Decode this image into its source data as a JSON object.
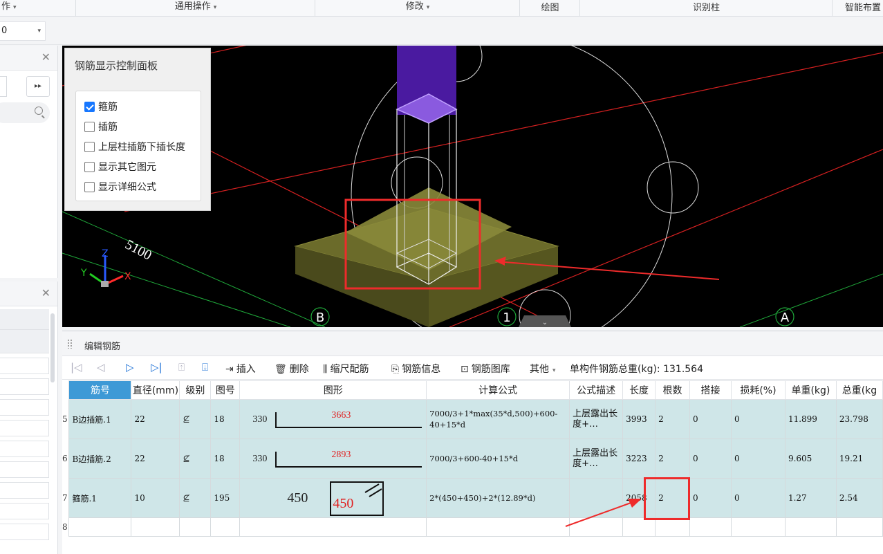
{
  "ribbon": {
    "groups": [
      {
        "label": "作",
        "caret": "▾"
      },
      {
        "label": "通用操作",
        "caret": "▾"
      },
      {
        "label": "修改",
        "caret": "▾"
      },
      {
        "label": "绘图",
        "caret": ""
      },
      {
        "label": "识别柱",
        "caret": ""
      },
      {
        "label": "智能布置",
        "caret": ""
      }
    ]
  },
  "subbar": {
    "zoom_value": "0"
  },
  "left_panel_top": {
    "expand_btn": "▸▸"
  },
  "control_panel": {
    "title": "钢筋显示控制面板",
    "options": [
      {
        "label": "箍筋",
        "checked": true
      },
      {
        "label": "插筋",
        "checked": false
      },
      {
        "label": "上层柱插筋下插长度",
        "checked": false
      },
      {
        "label": "显示其它图元",
        "checked": false
      },
      {
        "label": "显示详细公式",
        "checked": false
      }
    ]
  },
  "viewport": {
    "dim_label": "5100",
    "axis_x": "X",
    "axis_y": "Y",
    "axis_z": "Z",
    "grid_labels": [
      "B",
      "1",
      "A"
    ]
  },
  "edit_panel": {
    "title": "编辑钢筋",
    "tools": {
      "insert": "插入",
      "delete": "删除",
      "scale_rebar": "缩尺配筋",
      "rebar_info": "钢筋信息",
      "rebar_library": "钢筋图库",
      "other": "其他",
      "total_weight_label": "单构件钢筋总重(kg):",
      "total_weight_value": "131.564"
    },
    "columns": [
      "筋号",
      "直径(mm)",
      "级别",
      "图号",
      "图形",
      "计算公式",
      "公式描述",
      "长度",
      "根数",
      "搭接",
      "损耗(%)",
      "单重(kg)",
      "总重(kg"
    ],
    "rows": [
      {
        "num": "5",
        "name": "B边插筋.1",
        "diameter": "22",
        "grade": "⊈",
        "fig": "18",
        "shape_left": "330",
        "shape_red": "3663",
        "formula": "7000/3+1*max(35*d,500)+600-40+15*d",
        "desc": "上层露出长度+…",
        "length": "3993",
        "count": "2",
        "lap": "0",
        "loss": "0",
        "unit_w": "11.899",
        "total_w": "23.798"
      },
      {
        "num": "6",
        "name": "B边插筋.2",
        "diameter": "22",
        "grade": "⊈",
        "fig": "18",
        "shape_left": "330",
        "shape_red": "2893",
        "formula": "7000/3+600-40+15*d",
        "desc": "上层露出长度+…",
        "length": "3223",
        "count": "2",
        "lap": "0",
        "loss": "0",
        "unit_w": "9.605",
        "total_w": "19.21"
      },
      {
        "num": "7",
        "name": "箍筋.1",
        "diameter": "10",
        "grade": "⊈",
        "fig": "195",
        "shape_left": "450",
        "shape_red": "450",
        "formula": "2*(450+450)+2*(12.89*d)",
        "desc": "",
        "length": "2058",
        "count": "2",
        "lap": "0",
        "loss": "0",
        "unit_w": "1.27",
        "total_w": "2.54"
      }
    ],
    "empty_row_num": "8"
  },
  "colors": {
    "accent": "#3e99d6",
    "row_bg": "#cfe6e8",
    "highlight": "#ee2b2b"
  }
}
